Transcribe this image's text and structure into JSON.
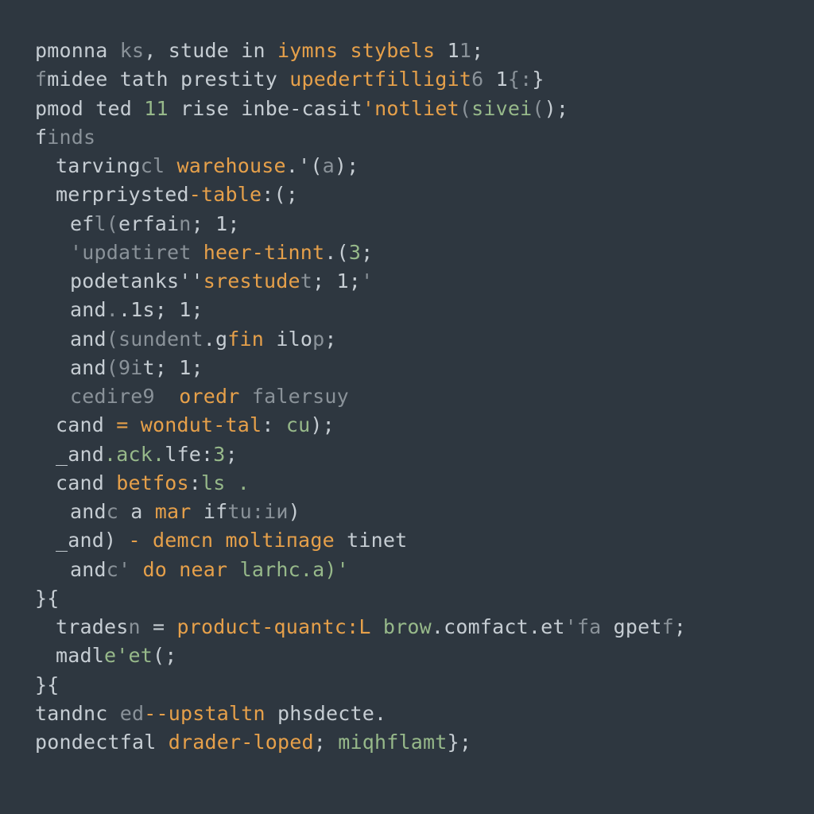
{
  "code": {
    "lines": [
      {
        "indent": 0,
        "tokens": [
          {
            "t": "pmonna ",
            "c": "def"
          },
          {
            "t": "ks",
            "c": "dim"
          },
          {
            "t": ", stude in ",
            "c": "def"
          },
          {
            "t": "iymns stybels",
            "c": "kw"
          },
          {
            "t": " 1",
            "c": "def"
          },
          {
            "t": "1",
            "c": "dim"
          },
          {
            "t": ";",
            "c": "def"
          }
        ]
      },
      {
        "indent": 0,
        "tokens": [
          {
            "t": "f",
            "c": "dim"
          },
          {
            "t": "midee tath prestity ",
            "c": "def"
          },
          {
            "t": "upedertfilligit",
            "c": "kw"
          },
          {
            "t": "6",
            "c": "dim"
          },
          {
            "t": " 1",
            "c": "def"
          },
          {
            "t": "{:",
            "c": "dim"
          },
          {
            "t": "}",
            "c": "def"
          }
        ]
      },
      {
        "indent": 0,
        "tokens": [
          {
            "t": "pmod ted ",
            "c": "def"
          },
          {
            "t": "11",
            "c": "str"
          },
          {
            "t": " rise inbe-casit",
            "c": "def"
          },
          {
            "t": "'notliet",
            "c": "kw"
          },
          {
            "t": "(",
            "c": "dim"
          },
          {
            "t": "sivei",
            "c": "str"
          },
          {
            "t": "(",
            "c": "dim"
          },
          {
            "t": ");",
            "c": "def"
          }
        ]
      },
      {
        "indent": 0,
        "tokens": [
          {
            "t": "f",
            "c": "def"
          },
          {
            "t": "inds",
            "c": "dim"
          }
        ]
      },
      {
        "indent": 1,
        "tokens": [
          {
            "t": "tarving",
            "c": "def"
          },
          {
            "t": "cl",
            "c": "dim"
          },
          {
            "t": " ",
            "c": "def"
          },
          {
            "t": "warehouse",
            "c": "kw"
          },
          {
            "t": ".'(",
            "c": "def"
          },
          {
            "t": "a",
            "c": "dim"
          },
          {
            "t": ");",
            "c": "def"
          }
        ]
      },
      {
        "indent": 1,
        "tokens": [
          {
            "t": "merpriysted",
            "c": "def"
          },
          {
            "t": "-table",
            "c": "kw"
          },
          {
            "t": ":(;",
            "c": "def"
          }
        ]
      },
      {
        "indent": 2,
        "tokens": [
          {
            "t": "ef",
            "c": "def"
          },
          {
            "t": "l(",
            "c": "dim"
          },
          {
            "t": "erfai",
            "c": "def"
          },
          {
            "t": "n",
            "c": "dim"
          },
          {
            "t": "; 1;",
            "c": "def"
          }
        ]
      },
      {
        "indent": 2,
        "tokens": [
          {
            "t": "'updatiret",
            "c": "dim"
          },
          {
            "t": " ",
            "c": "def"
          },
          {
            "t": "heer-tinnt",
            "c": "kw"
          },
          {
            "t": ".(",
            "c": "def"
          },
          {
            "t": "3",
            "c": "str"
          },
          {
            "t": ";",
            "c": "def"
          }
        ]
      },
      {
        "indent": 2,
        "tokens": [
          {
            "t": "podetanks''",
            "c": "def"
          },
          {
            "t": "srestude",
            "c": "kw"
          },
          {
            "t": "t",
            "c": "dim"
          },
          {
            "t": "; 1;",
            "c": "def"
          },
          {
            "t": "'",
            "c": "dim"
          }
        ]
      },
      {
        "indent": 2,
        "tokens": [
          {
            "t": "and",
            "c": "def"
          },
          {
            "t": ".",
            "c": "dim"
          },
          {
            "t": ".1s; 1;",
            "c": "def"
          }
        ]
      },
      {
        "indent": 2,
        "tokens": [
          {
            "t": "and",
            "c": "def"
          },
          {
            "t": "(sundent",
            "c": "dim"
          },
          {
            "t": ".g",
            "c": "def"
          },
          {
            "t": "fin",
            "c": "kw"
          },
          {
            "t": " ilo",
            "c": "def"
          },
          {
            "t": "p",
            "c": "dim"
          },
          {
            "t": ";",
            "c": "def"
          }
        ]
      },
      {
        "indent": 2,
        "tokens": [
          {
            "t": "and",
            "c": "def"
          },
          {
            "t": "(9i",
            "c": "dim"
          },
          {
            "t": "t; 1;",
            "c": "def"
          }
        ]
      },
      {
        "indent": 2,
        "tokens": [
          {
            "t": "cedire9",
            "c": "dim"
          },
          {
            "t": "  ",
            "c": "def"
          },
          {
            "t": "oredr",
            "c": "kw"
          },
          {
            "t": " ",
            "c": "def"
          },
          {
            "t": "falersuy",
            "c": "dim"
          }
        ]
      },
      {
        "indent": 1,
        "tokens": [
          {
            "t": "cand ",
            "c": "def"
          },
          {
            "t": "=",
            "c": "kw"
          },
          {
            "t": " ",
            "c": "def"
          },
          {
            "t": "wondut-tal",
            "c": "kw"
          },
          {
            "t": ": ",
            "c": "def"
          },
          {
            "t": "cu",
            "c": "str"
          },
          {
            "t": ");",
            "c": "def"
          }
        ]
      },
      {
        "indent": 1,
        "tokens": [
          {
            "t": "_and",
            "c": "def"
          },
          {
            "t": ".ack.",
            "c": "str"
          },
          {
            "t": "lfe:",
            "c": "def"
          },
          {
            "t": "3",
            "c": "str"
          },
          {
            "t": ";",
            "c": "def"
          }
        ]
      },
      {
        "indent": 1,
        "tokens": [
          {
            "t": "cand ",
            "c": "def"
          },
          {
            "t": "betfos",
            "c": "kw"
          },
          {
            "t": ":",
            "c": "def"
          },
          {
            "t": "ls .",
            "c": "str"
          }
        ]
      },
      {
        "indent": 2,
        "tokens": [
          {
            "t": "and",
            "c": "def"
          },
          {
            "t": "c",
            "c": "dim"
          },
          {
            "t": " a ",
            "c": "def"
          },
          {
            "t": "mar",
            "c": "kw"
          },
          {
            "t": " if",
            "c": "def"
          },
          {
            "t": "tu:iи",
            "c": "dim"
          },
          {
            "t": ")",
            "c": "def"
          }
        ]
      },
      {
        "indent": 1,
        "tokens": [
          {
            "t": "_and) ",
            "c": "def"
          },
          {
            "t": "-",
            "c": "kw"
          },
          {
            "t": " ",
            "c": "def"
          },
          {
            "t": "demcn moltiпage",
            "c": "kw"
          },
          {
            "t": " tinet",
            "c": "def"
          }
        ]
      },
      {
        "indent": 2,
        "tokens": [
          {
            "t": "and",
            "c": "def"
          },
          {
            "t": "c'",
            "c": "dim"
          },
          {
            "t": " ",
            "c": "def"
          },
          {
            "t": "do near",
            "c": "kw"
          },
          {
            "t": " ",
            "c": "def"
          },
          {
            "t": "larhc.a)'",
            "c": "str"
          }
        ]
      },
      {
        "indent": 0,
        "tokens": [
          {
            "t": "}{",
            "c": "def"
          }
        ]
      },
      {
        "indent": 1,
        "tokens": [
          {
            "t": "trades",
            "c": "def"
          },
          {
            "t": "n",
            "c": "dim"
          },
          {
            "t": " = ",
            "c": "def"
          },
          {
            "t": "product-quantc:L",
            "c": "kw"
          },
          {
            "t": " ",
            "c": "def"
          },
          {
            "t": "brow",
            "c": "str"
          },
          {
            "t": ".comfact.et",
            "c": "def"
          },
          {
            "t": "'fa",
            "c": "dim"
          },
          {
            "t": " gpet",
            "c": "def"
          },
          {
            "t": "f",
            "c": "dim"
          },
          {
            "t": ";",
            "c": "def"
          }
        ]
      },
      {
        "indent": 1,
        "tokens": [
          {
            "t": "madl",
            "c": "def"
          },
          {
            "t": "e'et",
            "c": "str"
          },
          {
            "t": "(;",
            "c": "def"
          }
        ]
      },
      {
        "indent": 0,
        "tokens": [
          {
            "t": "}{",
            "c": "def"
          }
        ]
      },
      {
        "indent": 0,
        "tokens": [
          {
            "t": "tandnc ",
            "c": "def"
          },
          {
            "t": "ed",
            "c": "dim"
          },
          {
            "t": "--upstaltn",
            "c": "kw"
          },
          {
            "t": " phsdecte.",
            "c": "def"
          }
        ]
      },
      {
        "indent": 0,
        "tokens": [
          {
            "t": "pondectfal ",
            "c": "def"
          },
          {
            "t": "drader-loped",
            "c": "kw"
          },
          {
            "t": "; ",
            "c": "def"
          },
          {
            "t": "miqhflamt",
            "c": "str"
          },
          {
            "t": "};",
            "c": "def"
          }
        ]
      }
    ]
  }
}
